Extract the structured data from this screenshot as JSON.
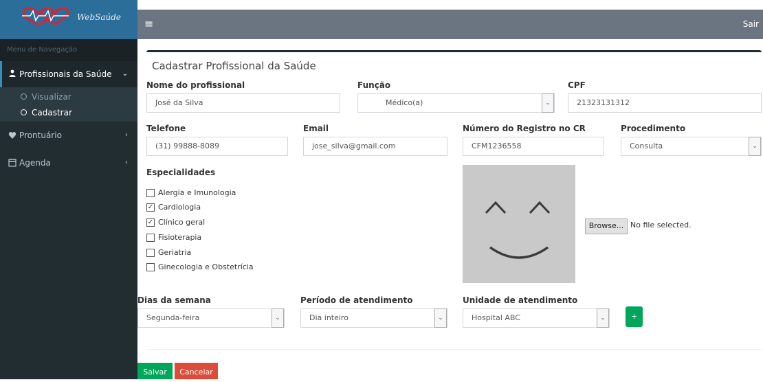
{
  "app": {
    "logo_text": "WebSaúde",
    "logout_label": "Sair"
  },
  "sidebar": {
    "header": "Menu de Navegação",
    "items": [
      {
        "label": "Profissionais da Saúde",
        "icon": "users-icon",
        "caret": "chevron-down-icon"
      },
      {
        "label": "Prontuário",
        "icon": "heartbeat-icon",
        "caret": "chevron-left-icon"
      },
      {
        "label": "Agenda",
        "icon": "calendar-icon",
        "caret": "chevron-left-icon"
      }
    ],
    "submenu": [
      {
        "label": "Visualizar"
      },
      {
        "label": "Cadastrar"
      }
    ]
  },
  "form": {
    "title": "Cadastrar Profissional da Saúde",
    "nome": {
      "label": "Nome do profissional",
      "value": "José da Silva"
    },
    "funcao": {
      "label": "Função",
      "value": "Médico(a)"
    },
    "cpf": {
      "label": "CPF",
      "value": "21323131312"
    },
    "telefone": {
      "label": "Telefone",
      "value": "(31) 99888-8089"
    },
    "email": {
      "label": "Email",
      "value": "jose_silva@gmail.com"
    },
    "registro": {
      "label": "Número do Registro no CR",
      "value": "CFM1236558"
    },
    "procedimento": {
      "label": "Procedimento",
      "value": "Consulta"
    },
    "especialidades": {
      "label": "Especialidades",
      "options": [
        {
          "label": "Alergia e Imunologia",
          "checked": false
        },
        {
          "label": "Cardiologia",
          "checked": true
        },
        {
          "label": "Clínico geral",
          "checked": true
        },
        {
          "label": "Fisioterapia",
          "checked": false
        },
        {
          "label": "Geriatria",
          "checked": false
        },
        {
          "label": "Ginecologia e Obstetrícia",
          "checked": false
        }
      ]
    },
    "photo": {
      "browse_label": "Browse...",
      "file_status": "No file selected."
    },
    "dias": {
      "label": "Dias da semana",
      "value": "Segunda-feira"
    },
    "periodo": {
      "label": "Período de atendimento",
      "value": "Dia inteiro"
    },
    "unidade": {
      "label": "Unidade de atendimento",
      "value": "Hospital ABC"
    },
    "add_label": "+",
    "save_label": "Salvar",
    "cancel_label": "Cancelar"
  },
  "colors": {
    "sidebar_bg": "#222d32",
    "topbar_bg": "#6b7582",
    "success": "#00a65a",
    "danger": "#dd4b39"
  }
}
